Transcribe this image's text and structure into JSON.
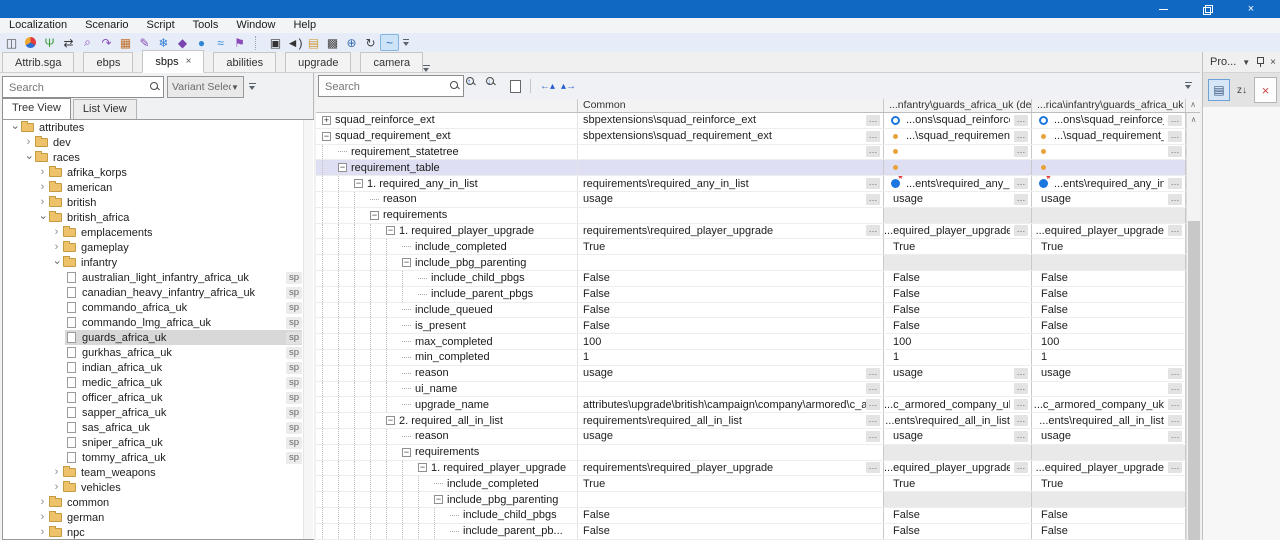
{
  "window": {
    "minimize": "–",
    "restore": "restore",
    "close": "×"
  },
  "menu_bar": {
    "items": [
      "Localization",
      "Scenario",
      "Script",
      "Tools",
      "Window",
      "Help"
    ]
  },
  "toolbar": {
    "icons": [
      {
        "name": "archive-icon",
        "glyph": "◫",
        "color": "#4a4a4a"
      },
      {
        "name": "color-wheel-icon",
        "glyph": "",
        "color": "wheel"
      },
      {
        "name": "tuning-fork-icon",
        "glyph": "Ψ",
        "color": "#3f9e3f"
      },
      {
        "name": "swap-arrows-icon",
        "glyph": "⇄",
        "color": "#3a3a3a"
      },
      {
        "name": "inspect-icon",
        "glyph": "⌕",
        "color": "#8a4bb8"
      },
      {
        "name": "export-icon",
        "glyph": "↷",
        "color": "#8a4bb8"
      },
      {
        "name": "texture-grid-icon",
        "glyph": "▦",
        "color": "#c2702e"
      },
      {
        "name": "pen-icon",
        "glyph": "✎",
        "color": "#8a4bb8"
      },
      {
        "name": "snowflake-icon",
        "glyph": "❄",
        "color": "#2e7bd6"
      },
      {
        "name": "shield-icon",
        "glyph": "◆",
        "color": "#7a44b0"
      },
      {
        "name": "droplet-icon",
        "glyph": "●",
        "color": "#2e86d6"
      },
      {
        "name": "waves-icon",
        "glyph": "≈",
        "color": "#2e86d6"
      },
      {
        "name": "flag-icon",
        "glyph": "⚑",
        "color": "#8a4bb8"
      },
      {
        "name": "sep",
        "type": "sep"
      },
      {
        "name": "capture-icon",
        "glyph": "▣",
        "color": "#333333"
      },
      {
        "name": "audio-icon",
        "glyph": "◄)",
        "color": "#333333"
      },
      {
        "name": "image-icon",
        "glyph": "▤",
        "color": "#cf9b3a"
      },
      {
        "name": "checkerboard-icon",
        "glyph": "▩",
        "color": "#444444"
      },
      {
        "name": "globe-search-icon",
        "glyph": "⊕",
        "color": "#3a6fb0"
      },
      {
        "name": "history-icon",
        "glyph": "↻",
        "color": "#444444"
      },
      {
        "name": "brush-tool-icon",
        "glyph": "~",
        "color": "#2e6fbe",
        "active": true
      },
      {
        "name": "overflow",
        "type": "overflow"
      }
    ]
  },
  "doc_tabs": [
    {
      "label": "Attrib.sga",
      "active": false,
      "closable": false
    },
    {
      "label": "ebps",
      "active": false,
      "closable": false
    },
    {
      "label": "sbps",
      "active": true,
      "closable": true
    },
    {
      "label": "abilities",
      "active": false,
      "closable": false
    },
    {
      "label": "upgrade",
      "active": false,
      "closable": false
    },
    {
      "label": "camera",
      "active": false,
      "closable": false
    }
  ],
  "left_panel": {
    "search_placeholder": "Search",
    "variant_selector": "Variant Selection",
    "view_tabs": [
      "Tree View",
      "List View"
    ],
    "active_view_tab": "Tree View",
    "tree": [
      {
        "level": 0,
        "kind": "folder",
        "state": "expanded",
        "label": "attributes"
      },
      {
        "level": 1,
        "kind": "folder",
        "state": "collapsed",
        "label": "dev"
      },
      {
        "level": 1,
        "kind": "folder",
        "state": "expanded",
        "label": "races"
      },
      {
        "level": 2,
        "kind": "folder",
        "state": "collapsed",
        "label": "afrika_korps"
      },
      {
        "level": 2,
        "kind": "folder",
        "state": "collapsed",
        "label": "american"
      },
      {
        "level": 2,
        "kind": "folder",
        "state": "collapsed",
        "label": "british"
      },
      {
        "level": 2,
        "kind": "folder",
        "state": "expanded",
        "label": "british_africa"
      },
      {
        "level": 3,
        "kind": "folder",
        "state": "collapsed",
        "label": "emplacements"
      },
      {
        "level": 3,
        "kind": "folder",
        "state": "collapsed",
        "label": "gameplay"
      },
      {
        "level": 3,
        "kind": "folder",
        "state": "expanded",
        "label": "infantry"
      },
      {
        "level": 4,
        "kind": "file",
        "label": "australian_light_infantry_africa_uk",
        "badge": "sp"
      },
      {
        "level": 4,
        "kind": "file",
        "label": "canadian_heavy_infantry_africa_uk",
        "badge": "sp"
      },
      {
        "level": 4,
        "kind": "file",
        "label": "commando_africa_uk",
        "badge": "sp"
      },
      {
        "level": 4,
        "kind": "file",
        "label": "commando_lmg_africa_uk",
        "badge": "sp"
      },
      {
        "level": 4,
        "kind": "file",
        "label": "guards_africa_uk",
        "badge": "sp",
        "selected": true
      },
      {
        "level": 4,
        "kind": "file",
        "label": "gurkhas_africa_uk",
        "badge": "sp"
      },
      {
        "level": 4,
        "kind": "file",
        "label": "indian_africa_uk",
        "badge": "sp"
      },
      {
        "level": 4,
        "kind": "file",
        "label": "medic_africa_uk",
        "badge": "sp"
      },
      {
        "level": 4,
        "kind": "file",
        "label": "officer_africa_uk",
        "badge": "sp"
      },
      {
        "level": 4,
        "kind": "file",
        "label": "sapper_africa_uk",
        "badge": "sp"
      },
      {
        "level": 4,
        "kind": "file",
        "label": "sas_africa_uk",
        "badge": "sp"
      },
      {
        "level": 4,
        "kind": "file",
        "label": "sniper_africa_uk",
        "badge": "sp"
      },
      {
        "level": 4,
        "kind": "file",
        "label": "tommy_africa_uk",
        "badge": "sp"
      },
      {
        "level": 3,
        "kind": "folder",
        "state": "collapsed",
        "label": "team_weapons"
      },
      {
        "level": 3,
        "kind": "folder",
        "state": "collapsed",
        "label": "vehicles"
      },
      {
        "level": 2,
        "kind": "folder",
        "state": "collapsed",
        "label": "common"
      },
      {
        "level": 2,
        "kind": "folder",
        "state": "collapsed",
        "label": "german"
      },
      {
        "level": 2,
        "kind": "folder",
        "state": "collapsed",
        "label": "npc"
      }
    ]
  },
  "grid": {
    "search_placeholder": "Search",
    "columns": [
      "",
      "Common",
      "...nfantry\\guards_africa_uk (default)",
      "...rica\\infantry\\guards_africa_uk (sp)"
    ],
    "rows": [
      {
        "label": "squad_reinforce_ext",
        "level": 0,
        "exp": "plus",
        "common": "sbpextensions\\squad_reinforce_ext",
        "commonEll": true,
        "ov": {
          "icon": "ref",
          "text": "...ons\\squad_reinforce_ext",
          "path": true,
          "ell": true
        }
      },
      {
        "label": "squad_requirement_ext",
        "level": 0,
        "exp": "minus",
        "common": "sbpextensions\\squad_requirement_ext",
        "commonEll": true,
        "ov": {
          "icon": "dot",
          "text": "...\\squad_requirement_ext",
          "path": true,
          "ell": true
        }
      },
      {
        "label": "requirement_statetree",
        "level": 1,
        "exp": "leaf",
        "common": "",
        "commonEll": true,
        "ov": {
          "icon": "dot",
          "text": "",
          "ell": true
        }
      },
      {
        "label": "requirement_table",
        "level": 1,
        "exp": "minus",
        "common": "",
        "selected": true,
        "ov": {
          "icon": "dot",
          "text": ""
        }
      },
      {
        "label": "1. required_any_in_list",
        "level": 2,
        "exp": "minus",
        "common": "requirements\\required_any_in_list",
        "commonEll": true,
        "ov": {
          "icon": "dotstar",
          "text": "...ents\\required_any_in_list",
          "path": true,
          "ell": true
        }
      },
      {
        "label": "reason",
        "level": 3,
        "exp": "leaf",
        "common": "usage",
        "commonEll": true,
        "ov": {
          "text": "usage",
          "ell": true
        }
      },
      {
        "label": "requirements",
        "level": 3,
        "exp": "minus",
        "common": "",
        "na": true
      },
      {
        "label": "1. required_player_upgrade",
        "level": 4,
        "exp": "minus",
        "common": "requirements\\required_player_upgrade",
        "commonEll": true,
        "ov": {
          "text": "...equired_player_upgrade",
          "path": true,
          "ell": true
        }
      },
      {
        "label": "include_completed",
        "level": 5,
        "exp": "leaf",
        "common": "True",
        "ov": {
          "text": "True"
        }
      },
      {
        "label": "include_pbg_parenting",
        "level": 5,
        "exp": "minus",
        "common": "",
        "na": true
      },
      {
        "label": "include_child_pbgs",
        "level": 6,
        "exp": "leaf",
        "common": "False",
        "ov": {
          "text": "False"
        }
      },
      {
        "label": "include_parent_pbgs",
        "level": 6,
        "exp": "leaf",
        "common": "False",
        "ov": {
          "text": "False"
        }
      },
      {
        "label": "include_queued",
        "level": 5,
        "exp": "leaf",
        "common": "False",
        "ov": {
          "text": "False"
        }
      },
      {
        "label": "is_present",
        "level": 5,
        "exp": "leaf",
        "common": "False",
        "ov": {
          "text": "False"
        }
      },
      {
        "label": "max_completed",
        "level": 5,
        "exp": "leaf",
        "common": "100",
        "ov": {
          "text": "100"
        }
      },
      {
        "label": "min_completed",
        "level": 5,
        "exp": "leaf",
        "common": "1",
        "ov": {
          "text": "1"
        }
      },
      {
        "label": "reason",
        "level": 5,
        "exp": "leaf",
        "common": "usage",
        "commonEll": true,
        "ov": {
          "text": "usage",
          "ell": true
        }
      },
      {
        "label": "ui_name",
        "level": 5,
        "exp": "leaf",
        "common": "",
        "commonEll": true,
        "ov": {
          "text": "",
          "ell": true
        }
      },
      {
        "label": "upgrade_name",
        "level": 5,
        "exp": "leaf",
        "common": "attributes\\upgrade\\british\\campaign\\company\\armored\\c_armored_c...",
        "commonEll": true,
        "ov": {
          "text": "...c_armored_company_uk",
          "path": true,
          "ell": true
        }
      },
      {
        "label": "2. required_all_in_list",
        "level": 4,
        "exp": "minus",
        "common": "requirements\\required_all_in_list",
        "commonEll": true,
        "ov": {
          "text": "...ents\\required_all_in_list",
          "path": true,
          "ell": true
        }
      },
      {
        "label": "reason",
        "level": 5,
        "exp": "leaf",
        "common": "usage",
        "commonEll": true,
        "ov": {
          "text": "usage",
          "ell": true
        }
      },
      {
        "label": "requirements",
        "level": 5,
        "exp": "minus",
        "common": "",
        "na": true
      },
      {
        "label": "1. required_player_upgrade",
        "level": 6,
        "exp": "minus",
        "common": "requirements\\required_player_upgrade",
        "commonEll": true,
        "ov": {
          "text": "...equired_player_upgrade",
          "path": true,
          "ell": true
        }
      },
      {
        "label": "include_completed",
        "level": 7,
        "exp": "leaf",
        "common": "True",
        "ov": {
          "text": "True"
        }
      },
      {
        "label": "include_pbg_parenting",
        "level": 7,
        "exp": "minus",
        "common": "",
        "na": true
      },
      {
        "label": "include_child_pbgs",
        "level": 8,
        "exp": "leaf",
        "common": "False",
        "ov": {
          "text": "False"
        }
      },
      {
        "label": "include_parent_pb...",
        "level": 8,
        "exp": "leaf",
        "common": "False",
        "ov": {
          "text": "False"
        }
      }
    ]
  },
  "right_panel": {
    "title": "Pro...",
    "close_glyph": "×",
    "sort_glyph": "z↓",
    "category_glyph": "▤"
  }
}
